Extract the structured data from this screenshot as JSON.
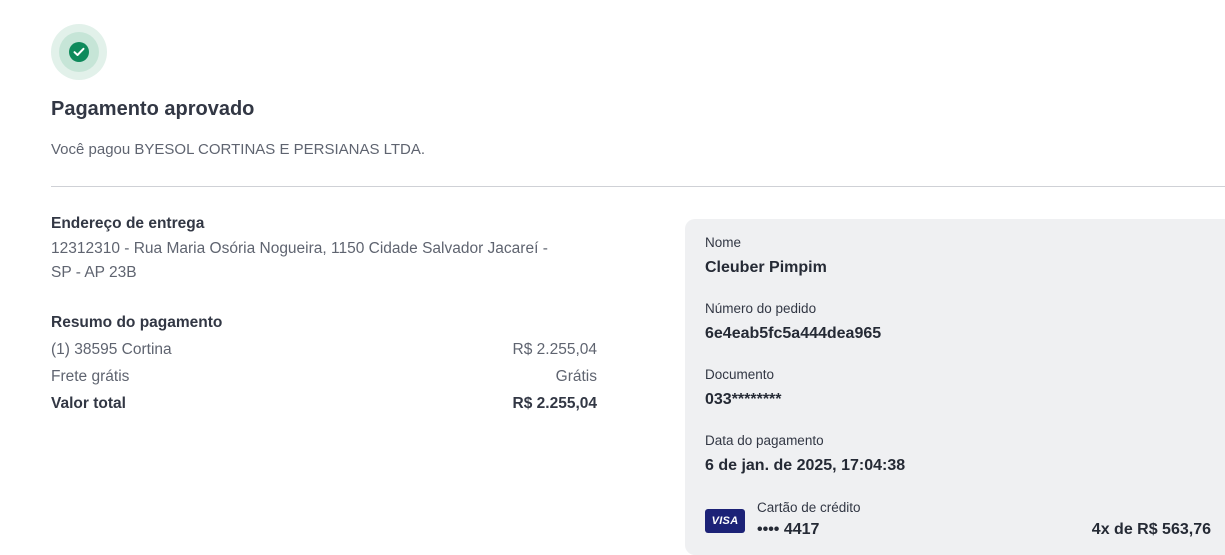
{
  "status": {
    "icon": "check-circle-icon",
    "color": "#0e8a5b",
    "title": "Pagamento aprovado",
    "subtitle": "Você pagou BYESOL CORTINAS E PERSIANAS LTDA."
  },
  "shipping": {
    "title": "Endereço de entrega",
    "address_line1": "12312310 - Rua Maria Osória Nogueira, 1150 Cidade Salvador Jacareí -",
    "address_line2": "SP - AP 23B"
  },
  "summary": {
    "title": "Resumo do pagamento",
    "rows": [
      {
        "label": "(1) 38595 Cortina",
        "value": "R$ 2.255,04"
      },
      {
        "label": "Frete grátis",
        "value": "Grátis"
      }
    ],
    "total": {
      "label": "Valor total",
      "value": "R$ 2.255,04"
    }
  },
  "details": {
    "name_label": "Nome",
    "name_value": "Cleuber Pimpim",
    "order_label": "Número do pedido",
    "order_value": "6e4eab5fc5a444dea965",
    "document_label": "Documento",
    "document_value": "033********",
    "date_label": "Data do pagamento",
    "date_value": "6 de jan. de 2025, 17:04:38"
  },
  "payment": {
    "brand": "VISA",
    "brand_color": "#1c2277",
    "method_label": "Cartão de crédito",
    "card_digits": "•••• 4417",
    "installments": "4x de R$ 563,76"
  }
}
